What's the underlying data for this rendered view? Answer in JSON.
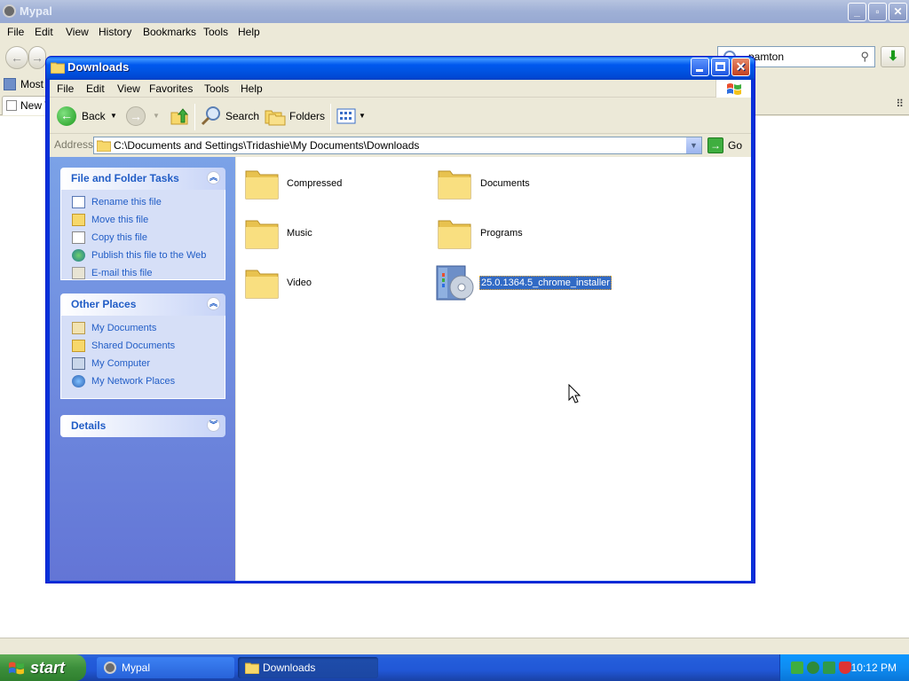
{
  "browser": {
    "title": "Mypal",
    "menu": [
      "File",
      "Edit",
      "View",
      "History",
      "Bookmarks",
      "Tools",
      "Help"
    ],
    "search_value": "pamton",
    "bookmark_label": "Most",
    "tab_label": "New T",
    "icons": [
      "back-arrow-icon",
      "forward-arrow-icon",
      "search-engine-icon",
      "magnifier-icon",
      "download-arrow-icon"
    ]
  },
  "explorer": {
    "title": "Downloads",
    "menu": [
      "File",
      "Edit",
      "View",
      "Favorites",
      "Tools",
      "Help"
    ],
    "toolbar": {
      "back": "Back",
      "search": "Search",
      "folders": "Folders"
    },
    "address": {
      "label": "Address",
      "path": "C:\\Documents and Settings\\Tridashie\\My Documents\\Downloads",
      "go": "Go"
    },
    "tasks": {
      "title": "File and Folder Tasks",
      "items": [
        "Rename this file",
        "Move this file",
        "Copy this file",
        "Publish this file to the Web",
        "E-mail this file"
      ]
    },
    "other_places": {
      "title": "Other Places",
      "items": [
        "My Documents",
        "Shared Documents",
        "My Computer",
        "My Network Places"
      ]
    },
    "details": {
      "title": "Details"
    },
    "files": [
      {
        "name": "Compressed",
        "type": "folder"
      },
      {
        "name": "Documents",
        "type": "folder"
      },
      {
        "name": "Music",
        "type": "folder"
      },
      {
        "name": "Programs",
        "type": "folder"
      },
      {
        "name": "Video",
        "type": "folder"
      },
      {
        "name": "25.0.1364.5_chrome_installer",
        "type": "installer",
        "selected": true
      }
    ]
  },
  "taskbar": {
    "start": "start",
    "buttons": [
      "Mypal",
      "Downloads"
    ],
    "clock": "10:12 PM"
  },
  "colors": {
    "xp_blue": "#0054e3",
    "taskpane_link": "#215dc6",
    "selection": "#316ac5",
    "start_green": "#3c8f3b"
  }
}
